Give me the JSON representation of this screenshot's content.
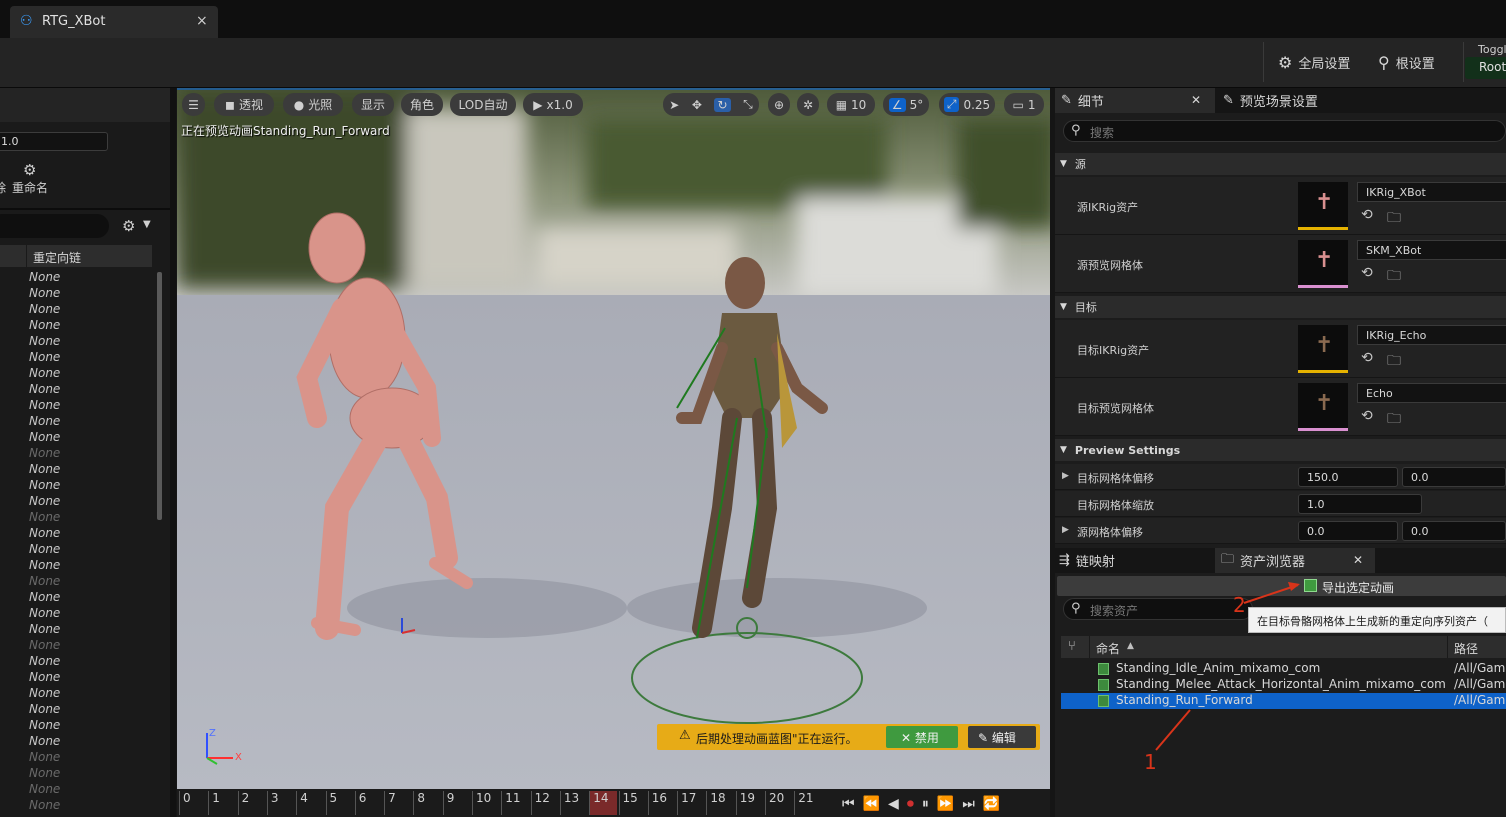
{
  "tab": {
    "title": "RTG_XBot",
    "close": "×"
  },
  "toolbar": {
    "global_settings": "全局设置",
    "root_settings": "根设置",
    "toggle_label": "Toggl",
    "root_button": "Root"
  },
  "left_panel": {
    "scale_value": "1.0",
    "rename_label": "重命名",
    "stub_char": "除",
    "column_header": "重定向链",
    "none_items": [
      "None",
      "None",
      "None",
      "None",
      "None",
      "None",
      "None",
      "None",
      "None",
      "None",
      "None",
      "None",
      "None",
      "None",
      "None",
      "None",
      "None",
      "None",
      "None",
      "None",
      "None",
      "None",
      "None",
      "None",
      "None",
      "None",
      "None",
      "None",
      "None",
      "None",
      "None",
      "None",
      "None",
      "None"
    ],
    "dim_rows": [
      11,
      15,
      19,
      23,
      30,
      31,
      32,
      33
    ]
  },
  "viewport": {
    "perspective": "透视",
    "lighting": "光照",
    "show": "显示",
    "character": "角色",
    "lod": "LOD自动",
    "play_speed": "x1.0",
    "preview_text": "正在预览动画Standing_Run_Forward",
    "grid_value": "10",
    "angle_value": "5°",
    "scale_snap": "0.25",
    "camera_speed": "1",
    "axis_x": "X",
    "axis_z": "Z",
    "warning_text": "后期处理动画蓝图\"正在运行。",
    "disable_button": "禁用",
    "edit_button": "编辑"
  },
  "timeline": {
    "ticks": [
      "0",
      "1",
      "2",
      "3",
      "4",
      "5",
      "6",
      "7",
      "8",
      "9",
      "10",
      "11",
      "12",
      "13",
      "14",
      "15",
      "16",
      "17",
      "18",
      "19",
      "20",
      "21"
    ],
    "current": "14"
  },
  "details": {
    "tab_details": "细节",
    "tab_preview": "预览场景设置",
    "search_placeholder": "搜索",
    "section_source": "源",
    "source_ikrig_label": "源IKRig资产",
    "source_ikrig_value": "IKRig_XBot",
    "source_mesh_label": "源预览网格体",
    "source_mesh_value": "SKM_XBot",
    "section_target": "目标",
    "target_ikrig_label": "目标IKRig资产",
    "target_ikrig_value": "IKRig_Echo",
    "target_mesh_label": "目标预览网格体",
    "target_mesh_value": "Echo",
    "section_preview": "Preview Settings",
    "target_offset_label": "目标网格体偏移",
    "target_offset_x": "150.0",
    "target_offset_y": "0.0",
    "target_scale_label": "目标网格体缩放",
    "target_scale_value": "1.0",
    "source_offset_label": "源网格体偏移",
    "source_offset_x": "0.0",
    "source_offset_y": "0.0"
  },
  "asset_browser": {
    "tab_chain": "链映射",
    "tab_assets": "资产浏览器",
    "export_button": "导出选定动画",
    "search_placeholder": "搜索资产",
    "tooltip": "在目标骨骼网格体上生成新的重定向序列资产（",
    "col_name": "命名",
    "col_path": "路径",
    "assets": [
      {
        "name": "Standing_Idle_Anim_mixamo_com",
        "path": "/All/Gam"
      },
      {
        "name": "Standing_Melee_Attack_Horizontal_Anim_mixamo_com",
        "path": "/All/Gam"
      },
      {
        "name": "Standing_Run_Forward",
        "path": "/All/Gam"
      }
    ],
    "annotation_1": "1",
    "annotation_2": "2"
  },
  "colors": {
    "accent_blue": "#0e62c9",
    "annotation_red": "#d9341a",
    "warning_yellow": "#e7ab17",
    "disable_green": "#3f9a3f"
  }
}
